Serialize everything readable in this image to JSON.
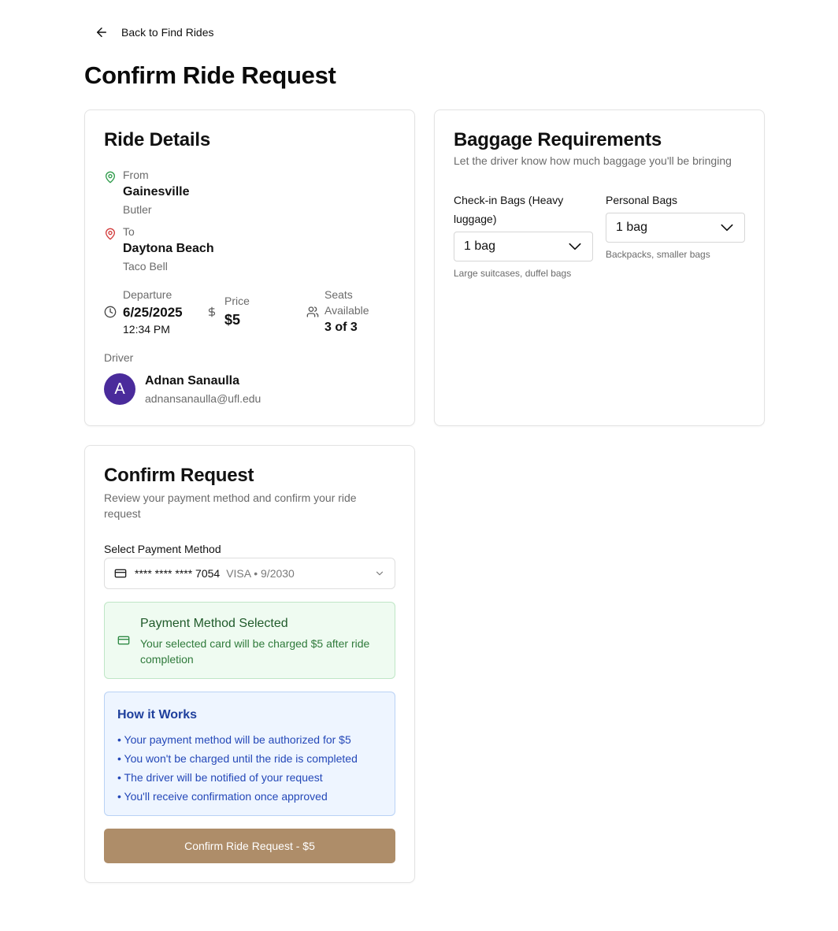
{
  "nav": {
    "back_label": "Back to Find Rides"
  },
  "page": {
    "title": "Confirm Ride Request"
  },
  "ride": {
    "title": "Ride Details",
    "from_label": "From",
    "from_city": "Gainesville",
    "from_place": "Butler",
    "to_label": "To",
    "to_city": "Daytona Beach",
    "to_place": "Taco Bell",
    "departure_label": "Departure",
    "departure_date": "6/25/2025",
    "departure_time": "12:34 PM",
    "price_label": "Price",
    "price": "$5",
    "seats_label_1": "Seats",
    "seats_label_2": "Available",
    "seats": "3 of 3",
    "driver_label": "Driver",
    "driver_initial": "A",
    "driver_name": "Adnan Sanaulla",
    "driver_email": "adnansanaulla@ufl.edu"
  },
  "baggage": {
    "title": "Baggage Requirements",
    "subtitle": "Let the driver know how much baggage you'll be bringing",
    "checkin_label_1": "Check-in Bags (Heavy",
    "checkin_label_2": "luggage)",
    "checkin_value": "1 bag",
    "checkin_hint": "Large suitcases, duffel bags",
    "personal_label": "Personal Bags",
    "personal_value": "1 bag",
    "personal_hint": "Backpacks, smaller bags"
  },
  "confirm": {
    "title": "Confirm Request",
    "subtitle_1": "Review your payment method and confirm your ride",
    "subtitle_2": "request",
    "payment_label": "Select Payment Method",
    "card_number": "**** **** **** 7054",
    "card_meta": "VISA • 9/2030",
    "selected_title": "Payment Method Selected",
    "selected_desc": "Your selected card will be charged $5 after ride completion",
    "how_title": "How it Works",
    "how_items": [
      "• Your payment method will be authorized for $5",
      "• You won't be charged until the ride is completed",
      "• The driver will be notified of your request",
      "• You'll receive confirmation once approved"
    ],
    "button_label": "Confirm Ride Request - $5"
  },
  "colors": {
    "accent_button": "#ae8d69",
    "avatar": "#4a2b9b",
    "from_pin": "#2e9b4a",
    "to_pin": "#d23b3b"
  },
  "icons": [
    "arrow-left-icon",
    "map-pin-icon",
    "clock-icon",
    "dollar-icon",
    "users-icon",
    "chevron-down-icon",
    "credit-card-icon"
  ]
}
